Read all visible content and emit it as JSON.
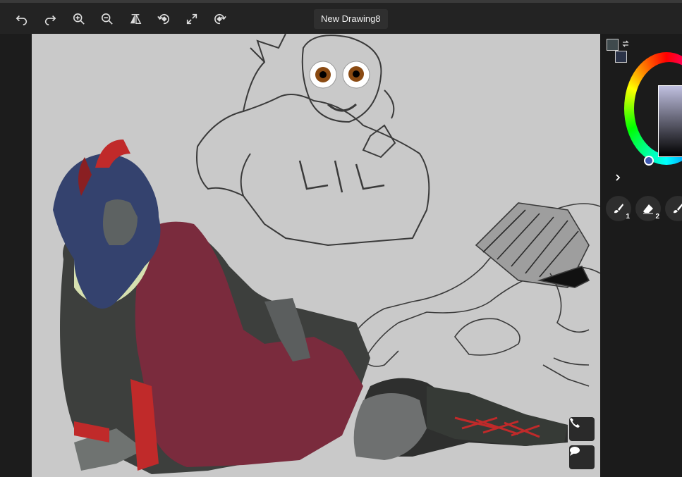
{
  "toolbar": {
    "document_title": "New Drawing8",
    "tools": [
      "undo-icon",
      "redo-icon",
      "zoom-in-icon",
      "zoom-out-icon",
      "flip-icon",
      "rotate-left-icon",
      "fullscreen-icon",
      "rotate-right-icon"
    ]
  },
  "colors": {
    "primary": "#3f4a4d",
    "secondary": "#2b3348",
    "canvas_bg": "#c9c9c9"
  },
  "right_panel": {
    "brushes": [
      {
        "icon": "brush-icon",
        "number": "1"
      },
      {
        "icon": "eraser-icon",
        "number": "2"
      },
      {
        "icon": "brush-icon",
        "number": ""
      }
    ]
  },
  "canvas": {
    "floating_buttons": [
      "phone-icon",
      "chat-icon"
    ]
  }
}
